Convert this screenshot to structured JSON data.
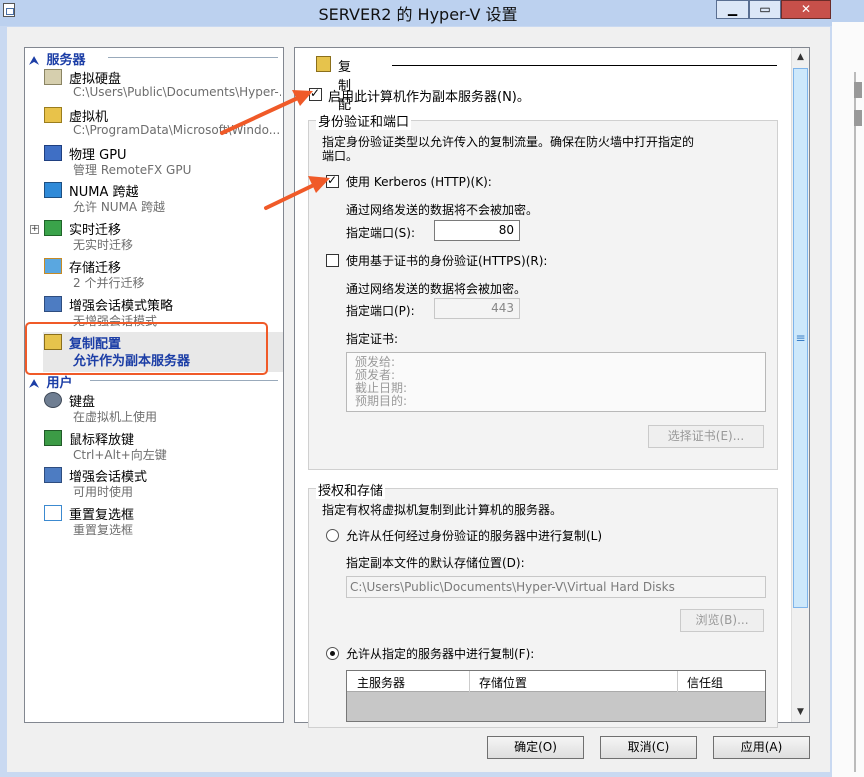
{
  "window": {
    "title": "SERVER2 的 Hyper-V 设置",
    "min_glyph": "▁",
    "max_glyph": "▭",
    "close_glyph": "✕"
  },
  "tree": {
    "category_server": "服务器",
    "category_user": "用户",
    "server_items": [
      {
        "label": "虚拟硬盘",
        "sub": "C:\\Users\\Public\\Documents\\Hyper-...",
        "icon": "disk-icon"
      },
      {
        "label": "虚拟机",
        "sub": "C:\\ProgramData\\Microsoft\\Windo...",
        "icon": "vm-icon"
      },
      {
        "label": "物理 GPU",
        "sub": "管理 RemoteFX GPU",
        "icon": "gpu-icon"
      },
      {
        "label": "NUMA 跨越",
        "sub": "允许 NUMA 跨越",
        "icon": "numa-icon"
      },
      {
        "label": "实时迁移",
        "sub": "无实时迁移",
        "icon": "live-migration-icon"
      },
      {
        "label": "存储迁移",
        "sub": "2 个并行迁移",
        "icon": "storage-migration-icon"
      },
      {
        "label": "增强会话模式策略",
        "sub": "无增强会话模式",
        "icon": "enhanced-session-policy-icon"
      },
      {
        "label": "复制配置",
        "sub": "允许作为副本服务器",
        "icon": "replication-icon"
      }
    ],
    "user_items": [
      {
        "label": "键盘",
        "sub": "在虚拟机上使用",
        "icon": "keyboard-icon"
      },
      {
        "label": "鼠标释放键",
        "sub": "Ctrl+Alt+向左键",
        "icon": "mouse-release-icon"
      },
      {
        "label": "增强会话模式",
        "sub": "可用时使用",
        "icon": "enhanced-session-icon"
      },
      {
        "label": "重置复选框",
        "sub": "重置复选框",
        "icon": "reset-checkbox-icon"
      }
    ]
  },
  "replication": {
    "section_title": "复制配置",
    "enable_label": "启用此计算机作为副本服务器(N)。",
    "enable_checked": true
  },
  "auth": {
    "group_title": "身份验证和端口",
    "desc_line1": "指定身份验证类型以允许传入的复制流量。确保在防火墙中打开指定的",
    "desc_line2": "端口。",
    "kerberos_label": "使用 Kerberos (HTTP)(K):",
    "kerberos_checked": true,
    "kerberos_note": "通过网络发送的数据将不会被加密。",
    "kerberos_port_label": "指定端口(S):",
    "kerberos_port": "80",
    "cert_label": "使用基于证书的身份验证(HTTPS)(R):",
    "cert_checked": false,
    "cert_note": "通过网络发送的数据将会被加密。",
    "cert_port_label": "指定端口(P):",
    "cert_port": "443",
    "cert_spec_label": "指定证书:",
    "cert_fields": [
      "颁发给:",
      "颁发者:",
      "截止日期:",
      "预期目的:"
    ],
    "select_cert_button": "选择证书(E)..."
  },
  "storage": {
    "group_title": "授权和存储",
    "desc": "指定有权将虚拟机复制到此计算机的服务器。",
    "any_server_label": "允许从任何经过身份验证的服务器中进行复制(L)",
    "any_server_selected": false,
    "default_location_label": "指定副本文件的默认存储位置(D):",
    "default_location_value": "C:\\Users\\Public\\Documents\\Hyper-V\\Virtual Hard Disks",
    "browse_button": "浏览(B)...",
    "specified_label": "允许从指定的服务器中进行复制(F):",
    "specified_selected": true,
    "table_headers": [
      "主服务器",
      "存储位置",
      "信任组"
    ]
  },
  "footer": {
    "ok": "确定(O)",
    "cancel": "取消(C)",
    "apply": "应用(A)"
  },
  "scroll": {
    "up_glyph": "▲",
    "down_glyph": "▼",
    "grip_glyph": "≡"
  },
  "tree_glyphs": {
    "collapse": "⮝",
    "expand_box": "+"
  },
  "colors": {
    "accent_blue": "#1c3ea6",
    "annotation_orange": "#f05a28",
    "close_red": "#c7504a"
  }
}
